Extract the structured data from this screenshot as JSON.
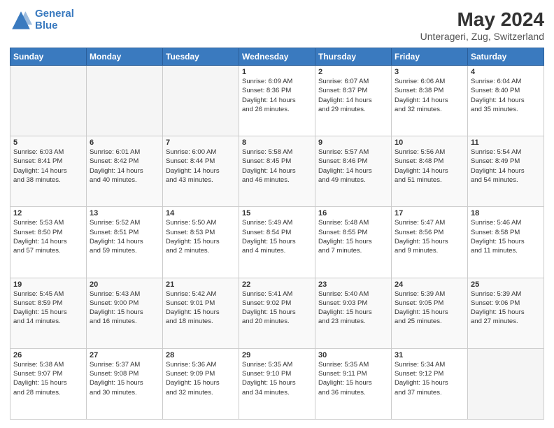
{
  "header": {
    "logo_line1": "General",
    "logo_line2": "Blue",
    "title": "May 2024",
    "subtitle": "Unterageri, Zug, Switzerland"
  },
  "weekdays": [
    "Sunday",
    "Monday",
    "Tuesday",
    "Wednesday",
    "Thursday",
    "Friday",
    "Saturday"
  ],
  "weeks": [
    [
      {
        "day": "",
        "info": ""
      },
      {
        "day": "",
        "info": ""
      },
      {
        "day": "",
        "info": ""
      },
      {
        "day": "1",
        "info": "Sunrise: 6:09 AM\nSunset: 8:36 PM\nDaylight: 14 hours\nand 26 minutes."
      },
      {
        "day": "2",
        "info": "Sunrise: 6:07 AM\nSunset: 8:37 PM\nDaylight: 14 hours\nand 29 minutes."
      },
      {
        "day": "3",
        "info": "Sunrise: 6:06 AM\nSunset: 8:38 PM\nDaylight: 14 hours\nand 32 minutes."
      },
      {
        "day": "4",
        "info": "Sunrise: 6:04 AM\nSunset: 8:40 PM\nDaylight: 14 hours\nand 35 minutes."
      }
    ],
    [
      {
        "day": "5",
        "info": "Sunrise: 6:03 AM\nSunset: 8:41 PM\nDaylight: 14 hours\nand 38 minutes."
      },
      {
        "day": "6",
        "info": "Sunrise: 6:01 AM\nSunset: 8:42 PM\nDaylight: 14 hours\nand 40 minutes."
      },
      {
        "day": "7",
        "info": "Sunrise: 6:00 AM\nSunset: 8:44 PM\nDaylight: 14 hours\nand 43 minutes."
      },
      {
        "day": "8",
        "info": "Sunrise: 5:58 AM\nSunset: 8:45 PM\nDaylight: 14 hours\nand 46 minutes."
      },
      {
        "day": "9",
        "info": "Sunrise: 5:57 AM\nSunset: 8:46 PM\nDaylight: 14 hours\nand 49 minutes."
      },
      {
        "day": "10",
        "info": "Sunrise: 5:56 AM\nSunset: 8:48 PM\nDaylight: 14 hours\nand 51 minutes."
      },
      {
        "day": "11",
        "info": "Sunrise: 5:54 AM\nSunset: 8:49 PM\nDaylight: 14 hours\nand 54 minutes."
      }
    ],
    [
      {
        "day": "12",
        "info": "Sunrise: 5:53 AM\nSunset: 8:50 PM\nDaylight: 14 hours\nand 57 minutes."
      },
      {
        "day": "13",
        "info": "Sunrise: 5:52 AM\nSunset: 8:51 PM\nDaylight: 14 hours\nand 59 minutes."
      },
      {
        "day": "14",
        "info": "Sunrise: 5:50 AM\nSunset: 8:53 PM\nDaylight: 15 hours\nand 2 minutes."
      },
      {
        "day": "15",
        "info": "Sunrise: 5:49 AM\nSunset: 8:54 PM\nDaylight: 15 hours\nand 4 minutes."
      },
      {
        "day": "16",
        "info": "Sunrise: 5:48 AM\nSunset: 8:55 PM\nDaylight: 15 hours\nand 7 minutes."
      },
      {
        "day": "17",
        "info": "Sunrise: 5:47 AM\nSunset: 8:56 PM\nDaylight: 15 hours\nand 9 minutes."
      },
      {
        "day": "18",
        "info": "Sunrise: 5:46 AM\nSunset: 8:58 PM\nDaylight: 15 hours\nand 11 minutes."
      }
    ],
    [
      {
        "day": "19",
        "info": "Sunrise: 5:45 AM\nSunset: 8:59 PM\nDaylight: 15 hours\nand 14 minutes."
      },
      {
        "day": "20",
        "info": "Sunrise: 5:43 AM\nSunset: 9:00 PM\nDaylight: 15 hours\nand 16 minutes."
      },
      {
        "day": "21",
        "info": "Sunrise: 5:42 AM\nSunset: 9:01 PM\nDaylight: 15 hours\nand 18 minutes."
      },
      {
        "day": "22",
        "info": "Sunrise: 5:41 AM\nSunset: 9:02 PM\nDaylight: 15 hours\nand 20 minutes."
      },
      {
        "day": "23",
        "info": "Sunrise: 5:40 AM\nSunset: 9:03 PM\nDaylight: 15 hours\nand 23 minutes."
      },
      {
        "day": "24",
        "info": "Sunrise: 5:39 AM\nSunset: 9:05 PM\nDaylight: 15 hours\nand 25 minutes."
      },
      {
        "day": "25",
        "info": "Sunrise: 5:39 AM\nSunset: 9:06 PM\nDaylight: 15 hours\nand 27 minutes."
      }
    ],
    [
      {
        "day": "26",
        "info": "Sunrise: 5:38 AM\nSunset: 9:07 PM\nDaylight: 15 hours\nand 28 minutes."
      },
      {
        "day": "27",
        "info": "Sunrise: 5:37 AM\nSunset: 9:08 PM\nDaylight: 15 hours\nand 30 minutes."
      },
      {
        "day": "28",
        "info": "Sunrise: 5:36 AM\nSunset: 9:09 PM\nDaylight: 15 hours\nand 32 minutes."
      },
      {
        "day": "29",
        "info": "Sunrise: 5:35 AM\nSunset: 9:10 PM\nDaylight: 15 hours\nand 34 minutes."
      },
      {
        "day": "30",
        "info": "Sunrise: 5:35 AM\nSunset: 9:11 PM\nDaylight: 15 hours\nand 36 minutes."
      },
      {
        "day": "31",
        "info": "Sunrise: 5:34 AM\nSunset: 9:12 PM\nDaylight: 15 hours\nand 37 minutes."
      },
      {
        "day": "",
        "info": ""
      }
    ]
  ],
  "colors": {
    "header_bg": "#3a7abf",
    "header_text": "#ffffff",
    "cell_border": "#cccccc",
    "alt_row": "#f0f4f9"
  }
}
